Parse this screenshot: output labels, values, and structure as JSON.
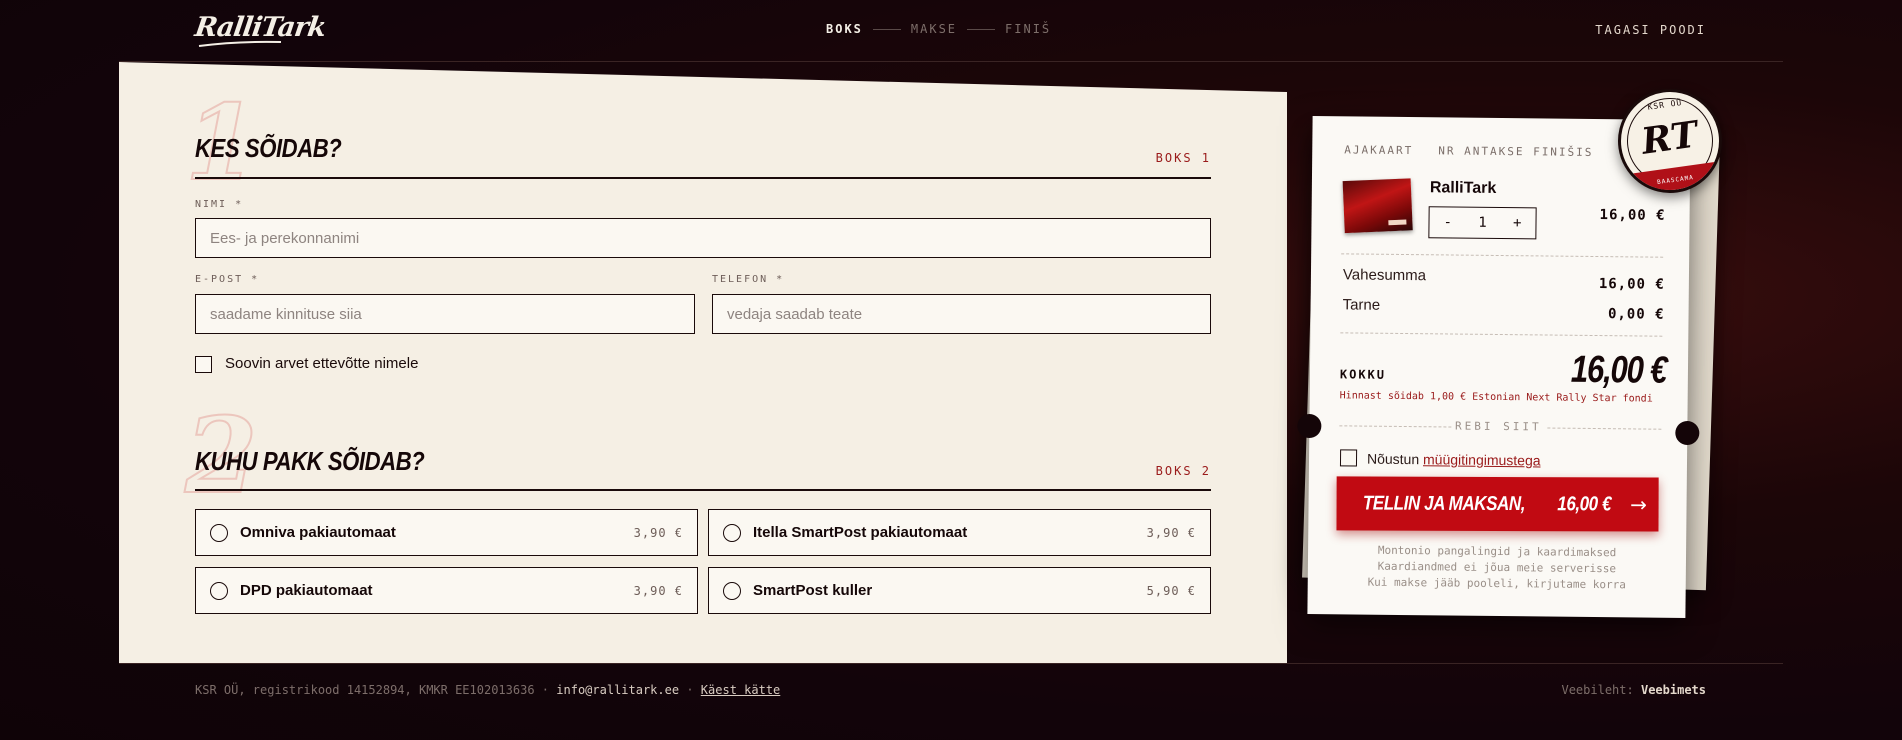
{
  "header": {
    "logo_text": "RalliTark",
    "steps": [
      "BOKS",
      "MAKSE",
      "FINIŠ"
    ],
    "back_link": "TAGASI POODI"
  },
  "form": {
    "section1": {
      "number": "1",
      "title": "KES SÕIDAB?",
      "box": "BOKS 1",
      "name_label": "NIMI *",
      "name_placeholder": "Ees- ja perekonnanimi",
      "email_label": "E-POST *",
      "email_placeholder": "saadame kinnituse siia",
      "phone_label": "TELEFON *",
      "phone_placeholder": "vedaja saadab teate",
      "company_checkbox": "Soovin arvet ettevõtte nimele"
    },
    "section2": {
      "number": "2",
      "title": "KUHU PAKK SÕIDAB?",
      "box": "BOKS 2",
      "options": [
        {
          "name": "Omniva pakiautomaat",
          "price": "3,90 €"
        },
        {
          "name": "Itella SmartPost pakiautomaat",
          "price": "3,90 €"
        },
        {
          "name": "DPD pakiautomaat",
          "price": "3,90 €"
        },
        {
          "name": "SmartPost kuller",
          "price": "5,90 €"
        }
      ]
    }
  },
  "receipt": {
    "head_left": "AJAKAART",
    "head_right": "NR ANTAKSE FINIŠIS",
    "product": {
      "name": "RalliTark",
      "qty": "1",
      "minus": "-",
      "plus": "+",
      "price": "16,00 €"
    },
    "subtotal_label": "Vahesumma",
    "subtotal_value": "16,00 €",
    "shipping_label": "Tarne",
    "shipping_value": "0,00 €",
    "total_label": "KOKKU",
    "total_value": "16,00 €",
    "charity_note": "Hinnast sõidab 1,00 € Estonian Next Rally Star fondi",
    "tear_label": "REBI SIIT",
    "terms_prefix": "Nõustun",
    "terms_link": "müügitingimustega",
    "pay_button": "TELLIN JA MAKSAN,",
    "pay_amount": "16,00 €",
    "pay_arrow": "→",
    "notes": [
      "Montonio pangalingid ja kaardimaksed",
      "Kaardiandmed ei jõua meie serverisse",
      "Kui makse jääb pooleli, kirjutame korra"
    ]
  },
  "stamp": {
    "top": "KSR OÜ",
    "monogram": "RT",
    "band": "BAASCAMA"
  },
  "footer": {
    "company": "KSR OÜ, registrikood 14152894, KMKR EE102013636",
    "sep": "·",
    "email": "info@rallitark.ee",
    "link": "Käest kätte",
    "website_prefix": "Veebileht:",
    "website_name": "Veebimets"
  }
}
